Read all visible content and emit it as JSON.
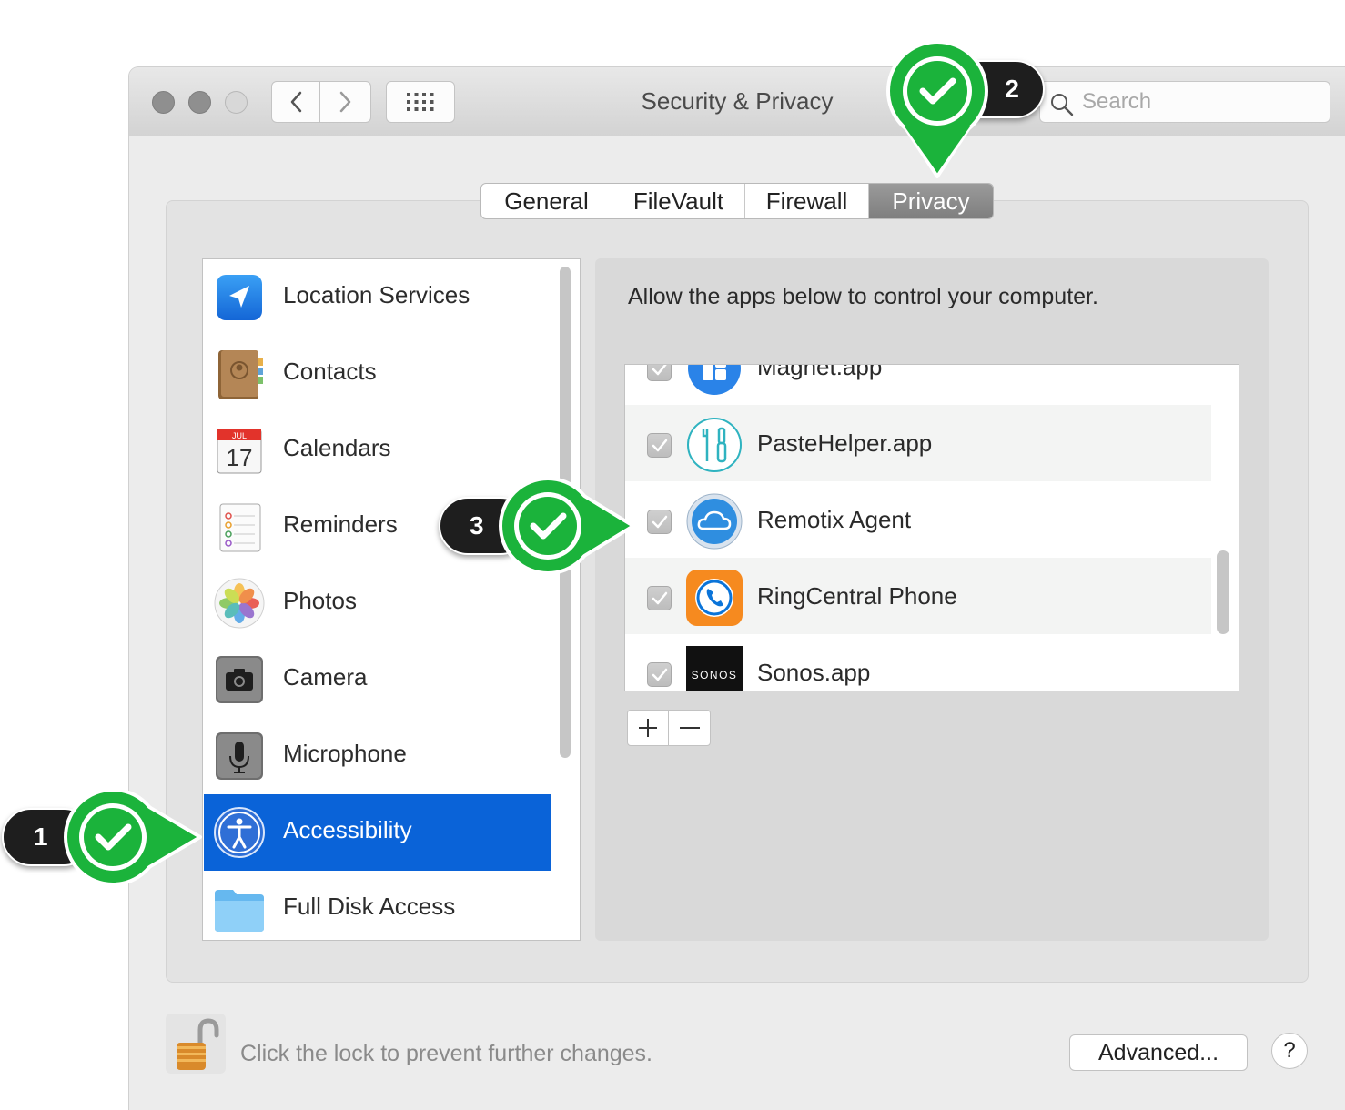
{
  "window": {
    "title": "Security & Privacy",
    "search_placeholder": "Search"
  },
  "tabs": [
    {
      "label": "General",
      "selected": false
    },
    {
      "label": "FileVault",
      "selected": false
    },
    {
      "label": "Firewall",
      "selected": false
    },
    {
      "label": "Privacy",
      "selected": true
    }
  ],
  "sidebar": {
    "items": [
      {
        "label": "Location Services",
        "icon": "location-arrow-icon"
      },
      {
        "label": "Contacts",
        "icon": "contacts-book-icon"
      },
      {
        "label": "Calendars",
        "icon": "calendar-icon",
        "icon_text": {
          "month": "JUL",
          "day": "17"
        }
      },
      {
        "label": "Reminders",
        "icon": "reminders-list-icon"
      },
      {
        "label": "Photos",
        "icon": "photos-flower-icon"
      },
      {
        "label": "Camera",
        "icon": "camera-icon"
      },
      {
        "label": "Microphone",
        "icon": "microphone-icon"
      },
      {
        "label": "Accessibility",
        "icon": "accessibility-person-icon",
        "selected": true
      },
      {
        "label": "Full Disk Access",
        "icon": "folder-icon"
      }
    ]
  },
  "privacy_panel": {
    "description": "Allow the apps below to control your computer.",
    "apps": [
      {
        "label": "Magnet.app",
        "checked": true,
        "icon": "magnet-app-icon"
      },
      {
        "label": "PasteHelper.app",
        "checked": true,
        "icon": "pastehelper-tools-icon"
      },
      {
        "label": "Remotix Agent",
        "checked": true,
        "icon": "remotix-cloud-icon"
      },
      {
        "label": "RingCentral Phone",
        "checked": true,
        "icon": "ringcentral-phone-icon"
      },
      {
        "label": "Sonos.app",
        "checked": true,
        "icon": "sonos-logo-icon",
        "icon_text": "SONOS"
      }
    ],
    "add_label": "+",
    "remove_label": "—"
  },
  "footer": {
    "lock_text": "Click the lock to prevent further changes.",
    "advanced_label": "Advanced...",
    "help_label": "?"
  },
  "callouts": [
    {
      "number": "1",
      "target": "Accessibility"
    },
    {
      "number": "2",
      "target": "Privacy"
    },
    {
      "number": "3",
      "target": "Remotix Agent"
    }
  ],
  "colors": {
    "selection_blue": "#0a63d8",
    "callout_green": "#1bb33b",
    "badge_dark": "#1e1e1e"
  }
}
